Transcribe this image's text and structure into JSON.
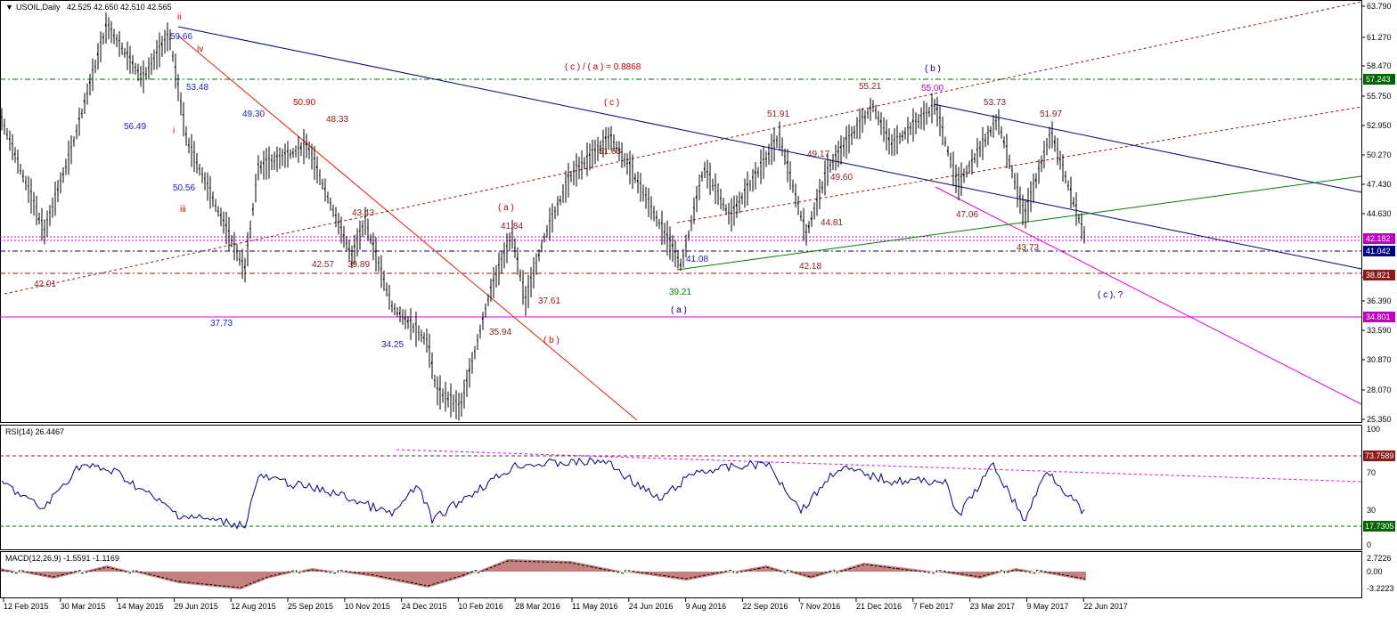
{
  "window": {
    "title_symbol": "USOIL,Daily",
    "ohlc": "42.525 42.650 42.510 42.565"
  },
  "price_axis": {
    "ticks": [
      "63.790",
      "61.270",
      "58.470",
      "55.750",
      "52.950",
      "50.270",
      "47.430",
      "44.630",
      "39.150",
      "36.390",
      "33.590",
      "30.870",
      "28.070",
      "25.350"
    ]
  },
  "price_badges": [
    {
      "text": "57.243",
      "color": "#006400"
    },
    {
      "text": "42.182",
      "color": "#c000c0"
    },
    {
      "text": "41.042",
      "color": "#000080"
    },
    {
      "text": "38.821",
      "color": "#8b1a1a"
    },
    {
      "text": "34.801",
      "color": "#c000c0"
    }
  ],
  "time_axis": {
    "labels": [
      "12 Feb 2015",
      "30 Mar 2015",
      "14 May 2015",
      "29 Jun 2015",
      "12 Aug 2015",
      "25 Sep 2015",
      "10 Nov 2015",
      "24 Dec 2015",
      "10 Feb 2016",
      "28 Mar 2016",
      "11 May 2016",
      "24 Jun 2016",
      "9 Aug 2016",
      "22 Sep 2016",
      "7 Nov 2016",
      "21 Dec 2016",
      "7 Feb 2017",
      "23 Mar 2017",
      "9 May 2017",
      "22 Jun 2017"
    ]
  },
  "annotations": {
    "wave_labels": [
      {
        "text": "ii",
        "color": "#c00000"
      },
      {
        "text": "iv",
        "color": "#c00000"
      },
      {
        "text": "i",
        "color": "#c00000"
      },
      {
        "text": "iii",
        "color": "#c00000"
      },
      {
        "text": "( a )",
        "color": "#c00000"
      },
      {
        "text": "( b )",
        "color": "#c00000"
      },
      {
        "text": "( c )",
        "color": "#c00000"
      },
      {
        "text": "( a )",
        "color": "#000080"
      },
      {
        "text": "( b )",
        "color": "#000080"
      },
      {
        "text": "( c ), ?",
        "color": "#000080"
      },
      {
        "text": "( c ) / ( a ) = 0.8868",
        "color": "#c00000"
      }
    ],
    "price_labels": [
      {
        "text": "59.66",
        "color": "#2020c0"
      },
      {
        "text": "53.48",
        "color": "#2020c0"
      },
      {
        "text": "56.49",
        "color": "#2020c0"
      },
      {
        "text": "49.30",
        "color": "#2020c0"
      },
      {
        "text": "50.56",
        "color": "#2020c0"
      },
      {
        "text": "37.73",
        "color": "#2020c0"
      },
      {
        "text": "34.25",
        "color": "#2020c0"
      },
      {
        "text": "41.08",
        "color": "#2020c0"
      },
      {
        "text": "50.90",
        "color": "#c00000"
      },
      {
        "text": "48.33",
        "color": "#8b1a1a"
      },
      {
        "text": "43.43",
        "color": "#8b1a1a"
      },
      {
        "text": "42.57",
        "color": "#8b1a1a"
      },
      {
        "text": "39.89",
        "color": "#8b1a1a"
      },
      {
        "text": "42.01",
        "color": "#8b1a1a"
      },
      {
        "text": "41.84",
        "color": "#8b1a1a"
      },
      {
        "text": "37.61",
        "color": "#8b1a1a"
      },
      {
        "text": "35.94",
        "color": "#8b1a1a"
      },
      {
        "text": "51.63",
        "color": "#8b1a1a"
      },
      {
        "text": "51.91",
        "color": "#8b1a1a"
      },
      {
        "text": "49.17",
        "color": "#8b1a1a"
      },
      {
        "text": "49.60",
        "color": "#8b1a1a"
      },
      {
        "text": "44.81",
        "color": "#8b1a1a"
      },
      {
        "text": "42.18",
        "color": "#8b1a1a"
      },
      {
        "text": "55.21",
        "color": "#8b1a1a"
      },
      {
        "text": "55.00",
        "color": "#c000c0"
      },
      {
        "text": "53.73",
        "color": "#8b1a1a"
      },
      {
        "text": "51.97",
        "color": "#8b1a1a"
      },
      {
        "text": "47.06",
        "color": "#8b1a1a"
      },
      {
        "text": "43.73",
        "color": "#8b1a1a"
      },
      {
        "text": "39.21",
        "color": "#008000"
      }
    ]
  },
  "rsi": {
    "title": "RSI(14) 26.4467",
    "ticks": [
      "100",
      "70",
      "30",
      "0"
    ],
    "badges": [
      {
        "text": "73.7589",
        "color": "#8b1a1a"
      },
      {
        "text": "17.7305",
        "color": "#006400"
      }
    ]
  },
  "macd": {
    "title": "MACD(12,26,9) -1.5591 -1.1169",
    "ticks": [
      "2.7226",
      "0.00",
      "-3.2223"
    ]
  },
  "colors": {
    "background": "#ffffff",
    "candle": "#000000",
    "rsi_line": "#000080",
    "macd_hist": "#8b0000",
    "blue_trend": "#000080",
    "red_trend": "#e02010",
    "green_trend": "#008000",
    "magenta": "#e000e0"
  }
}
